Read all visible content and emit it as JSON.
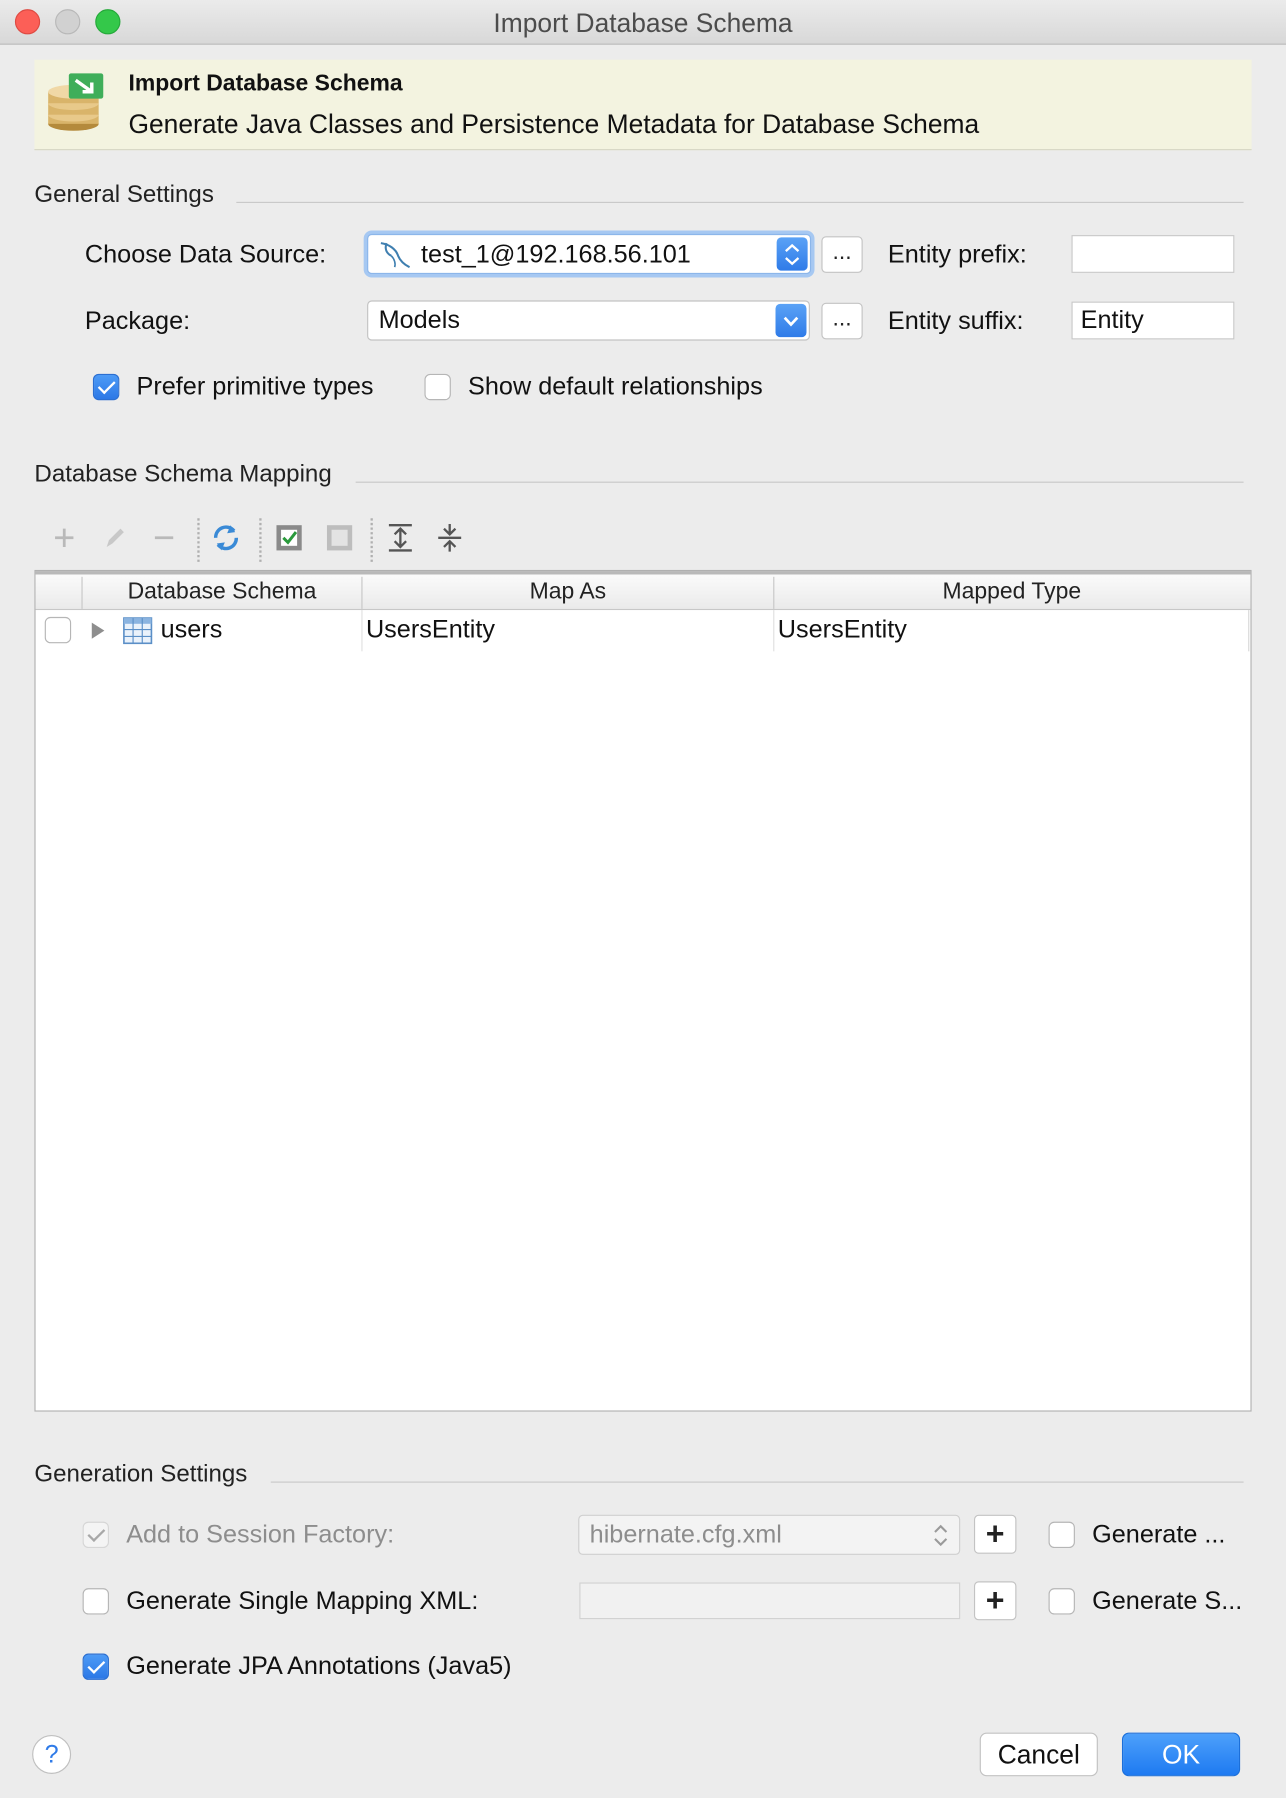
{
  "window": {
    "title": "Import Database Schema"
  },
  "banner": {
    "title": "Import Database Schema",
    "subtitle": "Generate Java Classes and Persistence Metadata for Database Schema"
  },
  "general": {
    "section_label": "General Settings",
    "data_source_label": "Choose Data Source:",
    "data_source_value": "test_1@192.168.56.101",
    "package_label": "Package:",
    "package_value": "Models",
    "browse_label": "...",
    "entity_prefix_label": "Entity prefix:",
    "entity_prefix_value": "",
    "entity_suffix_label": "Entity suffix:",
    "entity_suffix_value": "Entity",
    "prefer_primitive_label": "Prefer primitive types",
    "prefer_primitive_checked": true,
    "show_relationships_label": "Show default relationships",
    "show_relationships_checked": false
  },
  "mapping": {
    "section_label": "Database Schema Mapping",
    "toolbar": [
      "add-icon",
      "edit-icon",
      "remove-icon",
      "refresh-icon",
      "check-all-icon",
      "uncheck-all-icon",
      "expand-all-icon",
      "collapse-all-icon"
    ],
    "columns": [
      "Database Schema",
      "Map As",
      "Mapped Type"
    ],
    "rows": [
      {
        "checked": false,
        "schema": "users",
        "map_as": "UsersEntity",
        "mapped_type": "UsersEntity"
      }
    ]
  },
  "generation": {
    "section_label": "Generation Settings",
    "session_factory_label": "Add to Session Factory:",
    "session_factory_checked": true,
    "session_factory_enabled": false,
    "session_factory_value": "hibernate.cfg.xml",
    "generate_1_label": "Generate ...",
    "single_mapping_label": "Generate Single Mapping XML:",
    "single_mapping_value": "",
    "generate_2_label": "Generate S...",
    "jpa_label": "Generate JPA Annotations (Java5)",
    "jpa_checked": true,
    "plus_label": "+"
  },
  "footer": {
    "help_label": "?",
    "cancel_label": "Cancel",
    "ok_label": "OK"
  },
  "colors": {
    "accent": "#2f7be8",
    "banner_bg": "#f3f3e0",
    "window_bg": "#ececec"
  }
}
